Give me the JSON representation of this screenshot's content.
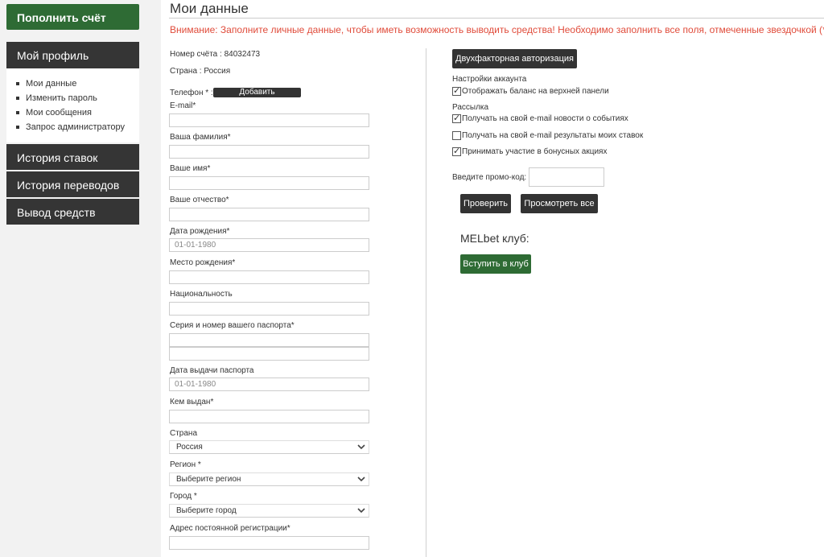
{
  "sidebar": {
    "topup_label": "Пополнить счёт",
    "profile_label": "Мой профиль",
    "submenu": [
      {
        "label": "Мои данные"
      },
      {
        "label": "Изменить пароль"
      },
      {
        "label": "Мои сообщения"
      },
      {
        "label": "Запрос администратору"
      }
    ],
    "bets_history": "История ставок",
    "transfers_history": "История переводов",
    "withdraw": "Вывод средств"
  },
  "main": {
    "title": "Мои данные",
    "warning": "Внимание: Заполните личные данные, чтобы иметь возможность выводить средства! Необходимо заполнить все поля, отмеченные звездочкой (*)",
    "account_number": "Номер счёта : 84032473",
    "country_line": "Страна : Россия",
    "phone_label": "Телефон * :",
    "add_label": "Добавить",
    "fields": {
      "email": {
        "label": "E-mail*",
        "value": ""
      },
      "surname": {
        "label": "Ваша фамилия*",
        "value": ""
      },
      "name": {
        "label": "Ваше имя*",
        "value": ""
      },
      "patronymic": {
        "label": "Ваше отчество*",
        "value": ""
      },
      "birthdate": {
        "label": "Дата рождения*",
        "value": "01-01-1980"
      },
      "birthplace": {
        "label": "Место рождения*",
        "value": ""
      },
      "nationality": {
        "label": "Национальность",
        "value": ""
      },
      "passport": {
        "label": "Серия и номер вашего паспорта*",
        "value": ""
      },
      "passport_date": {
        "label": "Дата выдачи паспорта",
        "value": "01-01-1980"
      },
      "issued_by": {
        "label": "Кем выдан*",
        "value": ""
      },
      "country": {
        "label": "Страна",
        "value": "Россия"
      },
      "region": {
        "label": "Регион *",
        "value": "Выберите регион"
      },
      "city": {
        "label": "Город *",
        "value": "Выберите город"
      },
      "address": {
        "label": "Адрес постоянной регистрации*",
        "value": ""
      }
    }
  },
  "right": {
    "twofa_label": "Двухфакторная авторизация",
    "account_settings_label": "Настройки аккаунта",
    "show_balance": {
      "label": "Отображать баланс на верхней панели",
      "checked": true
    },
    "newsletter_label": "Рассылка",
    "news_email": {
      "label": "Получать на свой e-mail новости о событиях",
      "checked": true
    },
    "results_email": {
      "label": "Получать на свой e-mail результаты моих ставок",
      "checked": false
    },
    "bonus": {
      "label": "Принимать участие в бонусных акциях",
      "checked": true
    },
    "promo_label": "Введите промо-код:",
    "check_label": "Проверить",
    "view_all_label": "Просмотреть все",
    "club_title": "MELbet клуб:",
    "join_label": "Вступить в клуб"
  },
  "colors": {
    "accent_green": "#2e6b34",
    "dark": "#353535",
    "warning": "#e04b3a"
  }
}
